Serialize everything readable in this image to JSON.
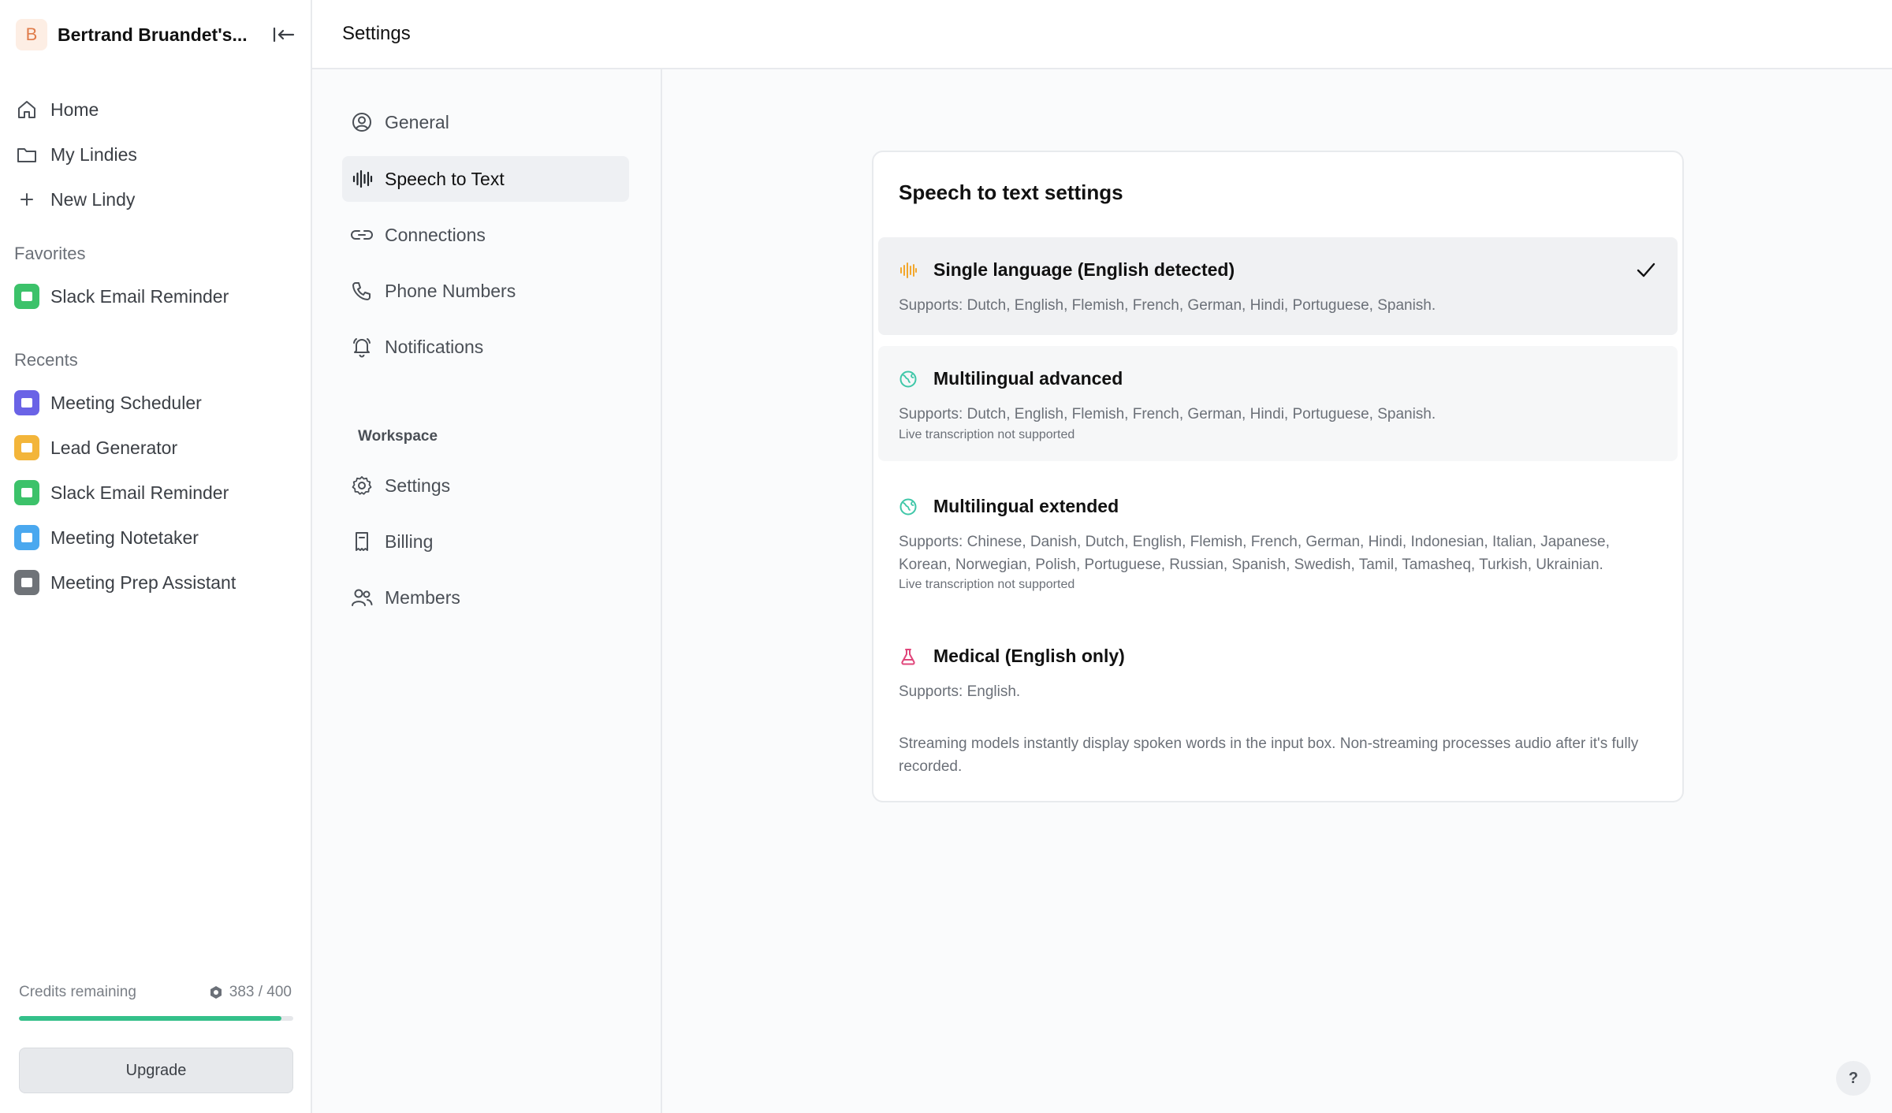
{
  "workspace": {
    "initial": "B",
    "name": "Bertrand Bruandet's..."
  },
  "sidebar": {
    "nav": [
      {
        "label": "Home",
        "icon": "home-icon"
      },
      {
        "label": "My Lindies",
        "icon": "folder-icon"
      },
      {
        "label": "New Lindy",
        "icon": "plus-icon"
      }
    ],
    "favorites_label": "Favorites",
    "favorites": [
      {
        "label": "Slack Email Reminder",
        "color": "#3cc26a"
      }
    ],
    "recents_label": "Recents",
    "recents": [
      {
        "label": "Meeting Scheduler",
        "color": "#6a63e6"
      },
      {
        "label": "Lead Generator",
        "color": "#f3b53a"
      },
      {
        "label": "Slack Email Reminder",
        "color": "#3cc26a"
      },
      {
        "label": "Meeting Notetaker",
        "color": "#4aa8ef"
      },
      {
        "label": "Meeting Prep Assistant",
        "color": "#6f7378"
      }
    ],
    "credits": {
      "label": "Credits remaining",
      "value": "383 / 400",
      "fraction": 0.9575
    },
    "upgrade_label": "Upgrade"
  },
  "header": {
    "title": "Settings"
  },
  "settings_nav": {
    "items": [
      {
        "label": "General",
        "icon": "user-circle-icon"
      },
      {
        "label": "Speech to Text",
        "icon": "waveform-icon",
        "active": true
      },
      {
        "label": "Connections",
        "icon": "link-icon"
      },
      {
        "label": "Phone Numbers",
        "icon": "phone-icon"
      },
      {
        "label": "Notifications",
        "icon": "bell-icon"
      }
    ],
    "workspace_label": "Workspace",
    "workspace_items": [
      {
        "label": "Settings",
        "icon": "gear-icon"
      },
      {
        "label": "Billing",
        "icon": "receipt-icon"
      },
      {
        "label": "Members",
        "icon": "users-icon"
      }
    ]
  },
  "main": {
    "card_title": "Speech to text settings",
    "options": [
      {
        "name": "Single language (English detected)",
        "supports": "Supports: Dutch, English, Flemish, French, German, Hindi, Portuguese, Spanish.",
        "note": "",
        "selected": true,
        "icon": "waveform-icon",
        "icon_color": "#f3a72b"
      },
      {
        "name": "Multilingual advanced",
        "supports": "Supports: Dutch, English, Flemish, French, German, Hindi, Portuguese, Spanish.",
        "note": "Live transcription not supported",
        "selected": false,
        "icon": "globe-icon",
        "icon_color": "#3fc7a8"
      },
      {
        "name": "Multilingual extended",
        "supports": "Supports: Chinese, Danish, Dutch, English, Flemish, French, German, Hindi, Indonesian, Italian, Japanese, Korean, Norwegian, Polish, Portuguese, Russian, Spanish, Swedish, Tamil, Tamasheq, Turkish, Ukrainian.",
        "note": "Live transcription not supported",
        "selected": false,
        "icon": "globe-icon",
        "icon_color": "#3fc7a8"
      },
      {
        "name": "Medical (English only)",
        "supports": "Supports: English.",
        "note": "",
        "selected": false,
        "icon": "flask-icon",
        "icon_color": "#e0457a"
      }
    ],
    "footer_note": "Streaming models instantly display spoken words in the input box. Non-streaming processes audio after it's fully recorded."
  },
  "help_label": "?"
}
